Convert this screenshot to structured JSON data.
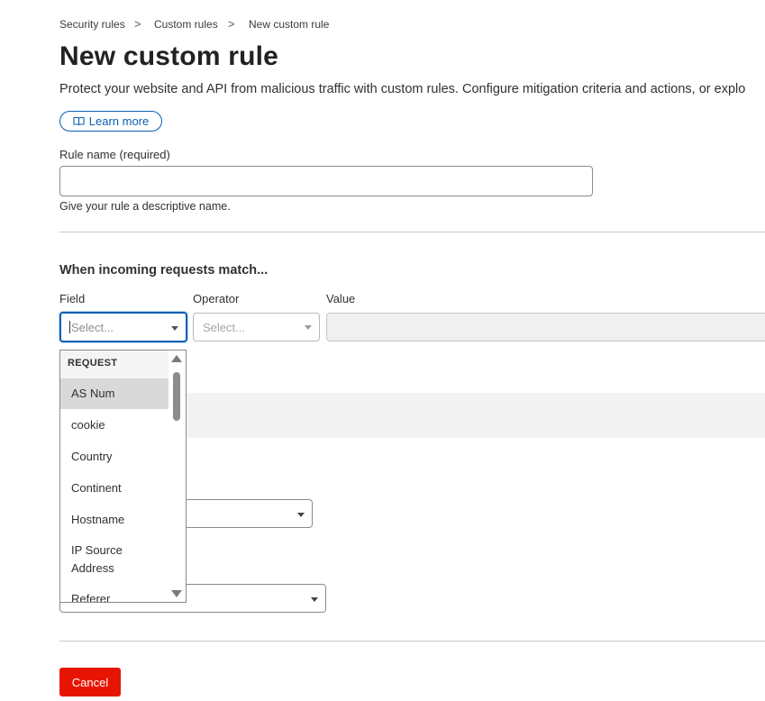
{
  "breadcrumb": {
    "items": [
      "Security rules",
      "Custom rules",
      "New custom rule"
    ],
    "separator": ">"
  },
  "page": {
    "title": "New custom rule",
    "description": "Protect your website and API from malicious traffic with custom rules. Configure mitigation criteria and actions, or explo",
    "learn_more": "Learn more"
  },
  "rule_name": {
    "label": "Rule name (required)",
    "value": "",
    "help": "Give your rule a descriptive name."
  },
  "match": {
    "heading": "When incoming requests match...",
    "field_label": "Field",
    "operator_label": "Operator",
    "value_label": "Value",
    "field_placeholder": "Select...",
    "operator_placeholder": "Select..."
  },
  "dropdown": {
    "group": "REQUEST",
    "items": [
      "AS Num",
      "cookie",
      "Country",
      "Continent",
      "Hostname",
      "IP Source Address",
      "Referer"
    ],
    "active_item": "AS Num"
  },
  "actions": {
    "cancel": "Cancel"
  },
  "colors": {
    "accent": "#0a5fb4",
    "danger": "#e81403"
  }
}
